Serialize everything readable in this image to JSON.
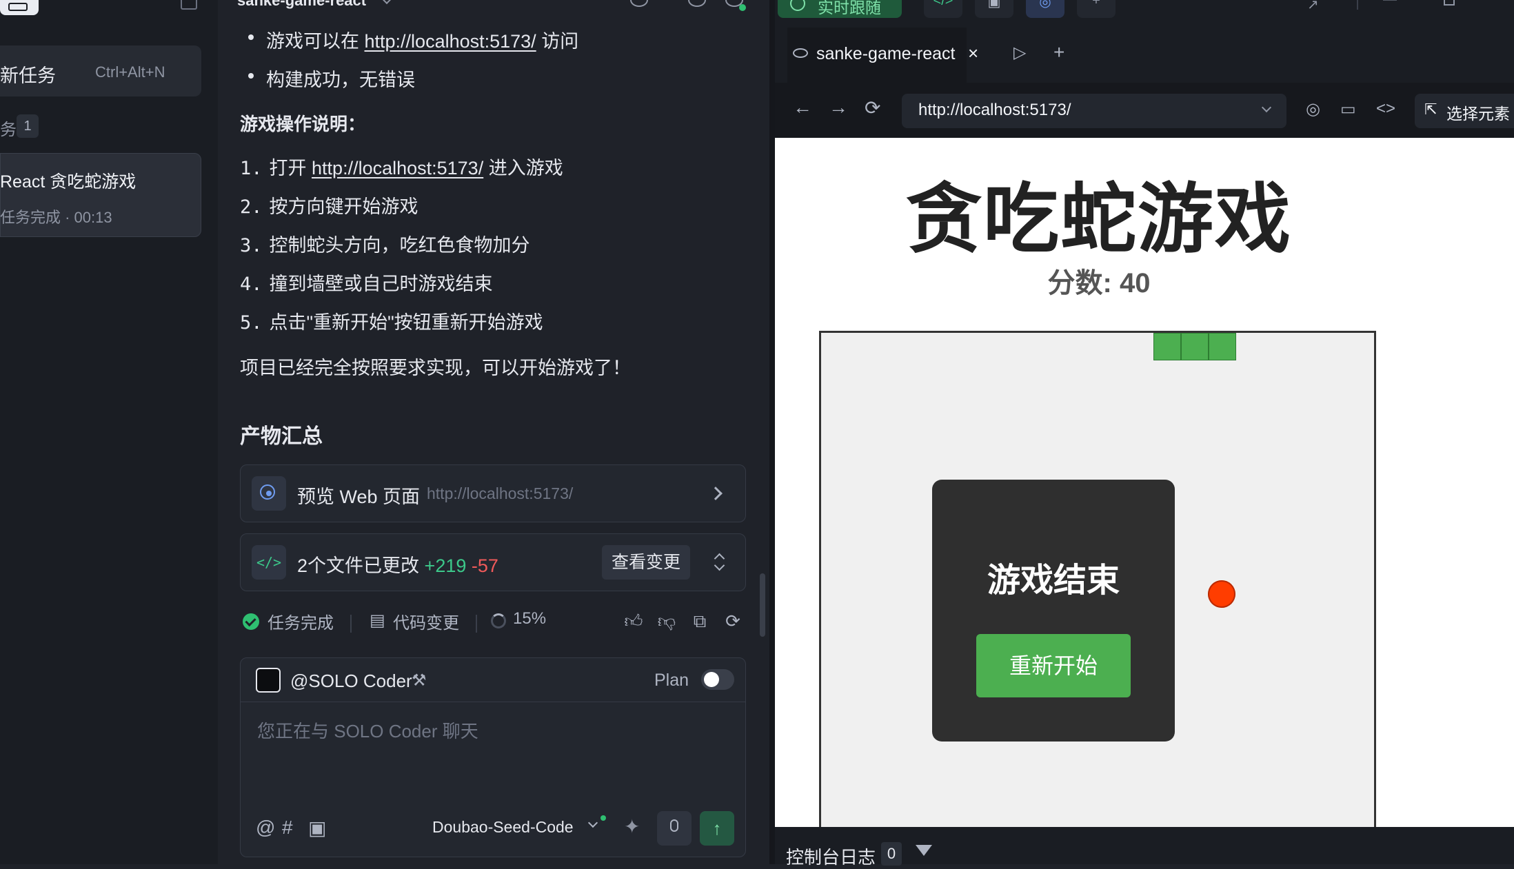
{
  "sidebar": {
    "new_task_label": "新任务",
    "new_task_shortcut": "Ctrl+Alt+N",
    "tasks_label": "务",
    "tasks_count": "1",
    "task": {
      "title": "React 贪吃蛇游戏",
      "meta": "任务完成 · 00:13"
    }
  },
  "chat": {
    "project_title": "sanke-game-react",
    "bullets": [
      {
        "prefix": "游戏可以在 ",
        "link": "http://localhost:5173/",
        "suffix": " 访问"
      },
      {
        "text": "构建成功，无错误"
      }
    ],
    "instructions_heading": "游戏操作说明：",
    "steps": [
      {
        "n": "1.",
        "prefix": "打开 ",
        "link": "http://localhost:5173/",
        "suffix": " 进入游戏"
      },
      {
        "n": "2.",
        "text": "按方向键开始游戏"
      },
      {
        "n": "3.",
        "text": "控制蛇头方向，吃红色食物加分"
      },
      {
        "n": "4.",
        "text": "撞到墙壁或自己时游戏结束"
      },
      {
        "n": "5.",
        "text": "点击\"重新开始\"按钮重新开始游戏"
      }
    ],
    "conclusion": "项目已经完全按照要求实现，可以开始游戏了！",
    "artifacts_heading": "产物汇总",
    "preview_card": {
      "title": "预览 Web 页面",
      "url": "http://localhost:5173/"
    },
    "changes_card": {
      "title": "2个文件已更改",
      "added": "+219",
      "removed": "-57",
      "button": "查看变更"
    },
    "status": {
      "done": "任务完成",
      "code_changes": "代码变更",
      "progress": "15%"
    },
    "composer": {
      "agent": "@SOLO Coder",
      "plan_label": "Plan",
      "placeholder": "您正在与 SOLO Coder 聊天",
      "model": "Doubao-Seed-Code"
    }
  },
  "preview": {
    "live_label": "实时跟随",
    "tab_label": "sanke-game-react",
    "url": "http://localhost:5173/",
    "select_element": "选择元素",
    "console_label": "控制台日志",
    "console_count": "0",
    "game": {
      "title": "贪吃蛇游戏",
      "score": "分数: 40",
      "game_over": "游戏结束",
      "restart": "重新开始"
    }
  },
  "colors": {
    "accent_green": "#2fbf71",
    "snake": "#4caf50",
    "food": "#ff3d00",
    "diff_add": "#3cc88a",
    "diff_remove": "#f05a5a"
  }
}
